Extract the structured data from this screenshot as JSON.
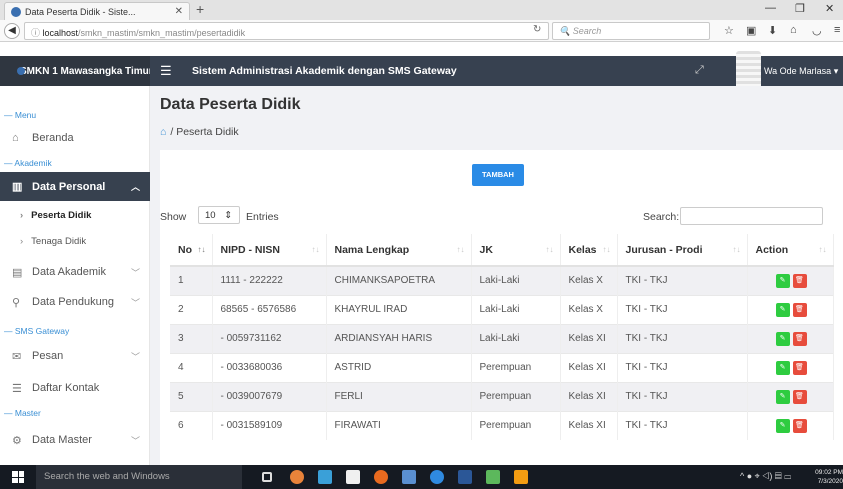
{
  "browser": {
    "tab_title": "Data Peserta Didik - Siste...",
    "url_host": "localhost",
    "url_path": "/smkn_mastim/smkn_mastim/pesertadidik",
    "search_placeholder": "Search"
  },
  "app": {
    "brand": "SMKN 1 Mawasangka Timur",
    "system_title": "Sistem Administrasi Akademik dengan SMS Gateway",
    "user_name": "Wa Ode Marlasa"
  },
  "sidebar": {
    "sections": {
      "menu": "Menu",
      "akademik": "Akademik",
      "sms": "SMS Gateway",
      "master": "Master"
    },
    "items": {
      "beranda": "Beranda",
      "data_personal": "Data Personal",
      "peserta_didik": "Peserta Didik",
      "tenaga_didik": "Tenaga Didik",
      "data_akademik": "Data Akademik",
      "data_pendukung": "Data Pendukung",
      "pesan": "Pesan",
      "daftar_kontak": "Daftar Kontak",
      "data_master": "Data Master"
    }
  },
  "page": {
    "title": "Data Peserta Didik",
    "breadcrumb": "Peserta Didik",
    "add_button": "TAMBAH",
    "show_label": "Show",
    "entries_value": "10",
    "entries_label": "Entries",
    "search_label": "Search:"
  },
  "table": {
    "headers": [
      "No",
      "NIPD - NISN",
      "Nama Lengkap",
      "JK",
      "Kelas",
      "Jurusan - Prodi",
      "Action"
    ],
    "rows": [
      [
        "1",
        "1111 - 222222",
        "CHIMANKSAPOETRA",
        "Laki-Laki",
        "Kelas X",
        "TKI - TKJ"
      ],
      [
        "2",
        "68565 - 6576586",
        "KHAYRUL IRAD",
        "Laki-Laki",
        "Kelas X",
        "TKI - TKJ"
      ],
      [
        "3",
        "- 0059731162",
        "ARDIANSYAH HARIS",
        "Laki-Laki",
        "Kelas XI",
        "TKI - TKJ"
      ],
      [
        "4",
        "- 0033680036",
        "ASTRID",
        "Perempuan",
        "Kelas XI",
        "TKI - TKJ"
      ],
      [
        "5",
        "- 0039007679",
        "FERLI",
        "Perempuan",
        "Kelas XI",
        "TKI - TKJ"
      ],
      [
        "6",
        "- 0031589109",
        "FIRAWATI",
        "Perempuan",
        "Kelas XI",
        "TKI - TKJ"
      ]
    ]
  },
  "taskbar": {
    "search_placeholder": "Search the web and Windows",
    "time": "09:02 PM",
    "date": "7/3/2020"
  },
  "colors": {
    "sidebar_active": "#37414f",
    "topbar": "#374150",
    "accent_blue": "#2a8be6",
    "edit_green": "#2ecc40",
    "delete_red": "#e74c3c"
  }
}
